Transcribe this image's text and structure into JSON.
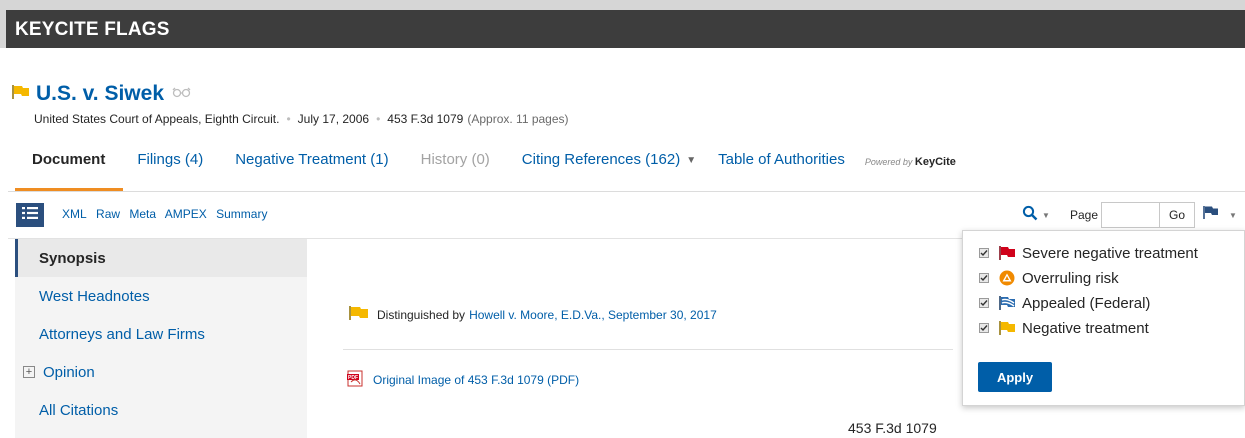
{
  "banner": {
    "title": "KEYCITE FLAGS"
  },
  "case": {
    "title": "U.S. v. Siwek",
    "court": "United States Court of Appeals, Eighth Circuit.",
    "date": "July 17, 2006",
    "citation": "453 F.3d 1079",
    "pages": "(Approx. 11 pages)"
  },
  "tabs": {
    "document": "Document",
    "filings": "Filings (4)",
    "negative_treatment": "Negative Treatment (1)",
    "history": "History (0)",
    "citing_references": "Citing References (162)",
    "table_of_authorities": "Table of Authorities",
    "powered_by": "Powered by",
    "keycite": "KeyCite"
  },
  "toolbar": {
    "links": [
      "XML",
      "Raw",
      "Meta",
      "AMPEX",
      "Summary"
    ],
    "page_label": "Page",
    "page_value": "",
    "go_label": "Go"
  },
  "sidebar": {
    "items": [
      {
        "label": "Synopsis"
      },
      {
        "label": "West Headnotes"
      },
      {
        "label": "Attorneys and Law Firms"
      },
      {
        "label": "Opinion"
      },
      {
        "label": "All Citations"
      }
    ]
  },
  "content": {
    "distinguished_prefix": "Distinguished by",
    "distinguished_link": "Howell v. Moore, E.D.Va., September 30, 2017",
    "original_image": "Original Image of 453 F.3d 1079 (PDF)",
    "citation_heading": "453 F.3d 1079"
  },
  "flag_filter": {
    "options": [
      {
        "label": "Severe negative treatment",
        "icon": "red-flag-icon",
        "checked": true
      },
      {
        "label": "Overruling risk",
        "icon": "orange-warning-icon",
        "checked": true
      },
      {
        "label": "Appealed (Federal)",
        "icon": "blue-striped-flag-icon",
        "checked": true
      },
      {
        "label": "Negative treatment",
        "icon": "yellow-flag-icon",
        "checked": true
      }
    ],
    "apply_label": "Apply"
  },
  "colors": {
    "link_blue": "#005ea8",
    "nav_dark": "#2b4f7e",
    "tab_underline": "#ef8d22",
    "red_flag": "#d0021b",
    "yellow_flag": "#f5b800",
    "orange_risk": "#f08a00",
    "banner_bg": "#3d3d3d"
  }
}
